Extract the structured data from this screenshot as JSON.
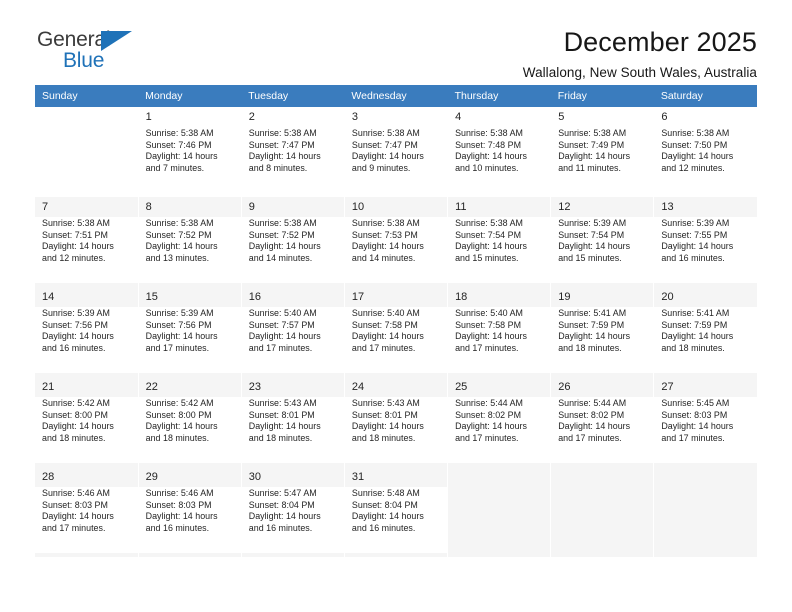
{
  "logo": {
    "word_one": "General",
    "word_two": "Blue",
    "triangle_color": "#1f72b8"
  },
  "header": {
    "title": "December 2025",
    "subtitle": "Wallalong, New South Wales, Australia"
  },
  "theme": {
    "header_row_background": "#3a7cbe",
    "header_row_text": "#ffffff",
    "shaded_row_background": "#f5f5f5",
    "page_background": "#ffffff",
    "text_color": "#242424"
  },
  "calendar": {
    "weekday_headers": [
      "Sunday",
      "Monday",
      "Tuesday",
      "Wednesday",
      "Thursday",
      "Friday",
      "Saturday"
    ],
    "weeks": [
      {
        "shaded": false,
        "days": [
          {
            "day": "",
            "sunrise": "",
            "sunset": "",
            "daylight_line1": "",
            "daylight_line2": "",
            "empty": true
          },
          {
            "day": "1",
            "sunrise": "Sunrise: 5:38 AM",
            "sunset": "Sunset: 7:46 PM",
            "daylight_line1": "Daylight: 14 hours",
            "daylight_line2": "and 7 minutes.",
            "empty": false
          },
          {
            "day": "2",
            "sunrise": "Sunrise: 5:38 AM",
            "sunset": "Sunset: 7:47 PM",
            "daylight_line1": "Daylight: 14 hours",
            "daylight_line2": "and 8 minutes.",
            "empty": false
          },
          {
            "day": "3",
            "sunrise": "Sunrise: 5:38 AM",
            "sunset": "Sunset: 7:47 PM",
            "daylight_line1": "Daylight: 14 hours",
            "daylight_line2": "and 9 minutes.",
            "empty": false
          },
          {
            "day": "4",
            "sunrise": "Sunrise: 5:38 AM",
            "sunset": "Sunset: 7:48 PM",
            "daylight_line1": "Daylight: 14 hours",
            "daylight_line2": "and 10 minutes.",
            "empty": false
          },
          {
            "day": "5",
            "sunrise": "Sunrise: 5:38 AM",
            "sunset": "Sunset: 7:49 PM",
            "daylight_line1": "Daylight: 14 hours",
            "daylight_line2": "and 11 minutes.",
            "empty": false
          },
          {
            "day": "6",
            "sunrise": "Sunrise: 5:38 AM",
            "sunset": "Sunset: 7:50 PM",
            "daylight_line1": "Daylight: 14 hours",
            "daylight_line2": "and 12 minutes.",
            "empty": false
          }
        ]
      },
      {
        "shaded": true,
        "days": [
          {
            "day": "7",
            "sunrise": "Sunrise: 5:38 AM",
            "sunset": "Sunset: 7:51 PM",
            "daylight_line1": "Daylight: 14 hours",
            "daylight_line2": "and 12 minutes.",
            "empty": false
          },
          {
            "day": "8",
            "sunrise": "Sunrise: 5:38 AM",
            "sunset": "Sunset: 7:52 PM",
            "daylight_line1": "Daylight: 14 hours",
            "daylight_line2": "and 13 minutes.",
            "empty": false
          },
          {
            "day": "9",
            "sunrise": "Sunrise: 5:38 AM",
            "sunset": "Sunset: 7:52 PM",
            "daylight_line1": "Daylight: 14 hours",
            "daylight_line2": "and 14 minutes.",
            "empty": false
          },
          {
            "day": "10",
            "sunrise": "Sunrise: 5:38 AM",
            "sunset": "Sunset: 7:53 PM",
            "daylight_line1": "Daylight: 14 hours",
            "daylight_line2": "and 14 minutes.",
            "empty": false
          },
          {
            "day": "11",
            "sunrise": "Sunrise: 5:38 AM",
            "sunset": "Sunset: 7:54 PM",
            "daylight_line1": "Daylight: 14 hours",
            "daylight_line2": "and 15 minutes.",
            "empty": false
          },
          {
            "day": "12",
            "sunrise": "Sunrise: 5:39 AM",
            "sunset": "Sunset: 7:54 PM",
            "daylight_line1": "Daylight: 14 hours",
            "daylight_line2": "and 15 minutes.",
            "empty": false
          },
          {
            "day": "13",
            "sunrise": "Sunrise: 5:39 AM",
            "sunset": "Sunset: 7:55 PM",
            "daylight_line1": "Daylight: 14 hours",
            "daylight_line2": "and 16 minutes.",
            "empty": false
          }
        ]
      },
      {
        "shaded": true,
        "days": [
          {
            "day": "14",
            "sunrise": "Sunrise: 5:39 AM",
            "sunset": "Sunset: 7:56 PM",
            "daylight_line1": "Daylight: 14 hours",
            "daylight_line2": "and 16 minutes.",
            "empty": false
          },
          {
            "day": "15",
            "sunrise": "Sunrise: 5:39 AM",
            "sunset": "Sunset: 7:56 PM",
            "daylight_line1": "Daylight: 14 hours",
            "daylight_line2": "and 17 minutes.",
            "empty": false
          },
          {
            "day": "16",
            "sunrise": "Sunrise: 5:40 AM",
            "sunset": "Sunset: 7:57 PM",
            "daylight_line1": "Daylight: 14 hours",
            "daylight_line2": "and 17 minutes.",
            "empty": false
          },
          {
            "day": "17",
            "sunrise": "Sunrise: 5:40 AM",
            "sunset": "Sunset: 7:58 PM",
            "daylight_line1": "Daylight: 14 hours",
            "daylight_line2": "and 17 minutes.",
            "empty": false
          },
          {
            "day": "18",
            "sunrise": "Sunrise: 5:40 AM",
            "sunset": "Sunset: 7:58 PM",
            "daylight_line1": "Daylight: 14 hours",
            "daylight_line2": "and 17 minutes.",
            "empty": false
          },
          {
            "day": "19",
            "sunrise": "Sunrise: 5:41 AM",
            "sunset": "Sunset: 7:59 PM",
            "daylight_line1": "Daylight: 14 hours",
            "daylight_line2": "and 18 minutes.",
            "empty": false
          },
          {
            "day": "20",
            "sunrise": "Sunrise: 5:41 AM",
            "sunset": "Sunset: 7:59 PM",
            "daylight_line1": "Daylight: 14 hours",
            "daylight_line2": "and 18 minutes.",
            "empty": false
          }
        ]
      },
      {
        "shaded": true,
        "days": [
          {
            "day": "21",
            "sunrise": "Sunrise: 5:42 AM",
            "sunset": "Sunset: 8:00 PM",
            "daylight_line1": "Daylight: 14 hours",
            "daylight_line2": "and 18 minutes.",
            "empty": false
          },
          {
            "day": "22",
            "sunrise": "Sunrise: 5:42 AM",
            "sunset": "Sunset: 8:00 PM",
            "daylight_line1": "Daylight: 14 hours",
            "daylight_line2": "and 18 minutes.",
            "empty": false
          },
          {
            "day": "23",
            "sunrise": "Sunrise: 5:43 AM",
            "sunset": "Sunset: 8:01 PM",
            "daylight_line1": "Daylight: 14 hours",
            "daylight_line2": "and 18 minutes.",
            "empty": false
          },
          {
            "day": "24",
            "sunrise": "Sunrise: 5:43 AM",
            "sunset": "Sunset: 8:01 PM",
            "daylight_line1": "Daylight: 14 hours",
            "daylight_line2": "and 18 minutes.",
            "empty": false
          },
          {
            "day": "25",
            "sunrise": "Sunrise: 5:44 AM",
            "sunset": "Sunset: 8:02 PM",
            "daylight_line1": "Daylight: 14 hours",
            "daylight_line2": "and 17 minutes.",
            "empty": false
          },
          {
            "day": "26",
            "sunrise": "Sunrise: 5:44 AM",
            "sunset": "Sunset: 8:02 PM",
            "daylight_line1": "Daylight: 14 hours",
            "daylight_line2": "and 17 minutes.",
            "empty": false
          },
          {
            "day": "27",
            "sunrise": "Sunrise: 5:45 AM",
            "sunset": "Sunset: 8:03 PM",
            "daylight_line1": "Daylight: 14 hours",
            "daylight_line2": "and 17 minutes.",
            "empty": false
          }
        ]
      },
      {
        "shaded": true,
        "days": [
          {
            "day": "28",
            "sunrise": "Sunrise: 5:46 AM",
            "sunset": "Sunset: 8:03 PM",
            "daylight_line1": "Daylight: 14 hours",
            "daylight_line2": "and 17 minutes.",
            "empty": false
          },
          {
            "day": "29",
            "sunrise": "Sunrise: 5:46 AM",
            "sunset": "Sunset: 8:03 PM",
            "daylight_line1": "Daylight: 14 hours",
            "daylight_line2": "and 16 minutes.",
            "empty": false
          },
          {
            "day": "30",
            "sunrise": "Sunrise: 5:47 AM",
            "sunset": "Sunset: 8:04 PM",
            "daylight_line1": "Daylight: 14 hours",
            "daylight_line2": "and 16 minutes.",
            "empty": false
          },
          {
            "day": "31",
            "sunrise": "Sunrise: 5:48 AM",
            "sunset": "Sunset: 8:04 PM",
            "daylight_line1": "Daylight: 14 hours",
            "daylight_line2": "and 16 minutes.",
            "empty": false
          },
          {
            "day": "",
            "sunrise": "",
            "sunset": "",
            "daylight_line1": "",
            "daylight_line2": "",
            "empty": true
          },
          {
            "day": "",
            "sunrise": "",
            "sunset": "",
            "daylight_line1": "",
            "daylight_line2": "",
            "empty": true
          },
          {
            "day": "",
            "sunrise": "",
            "sunset": "",
            "daylight_line1": "",
            "daylight_line2": "",
            "empty": true
          }
        ]
      }
    ]
  }
}
